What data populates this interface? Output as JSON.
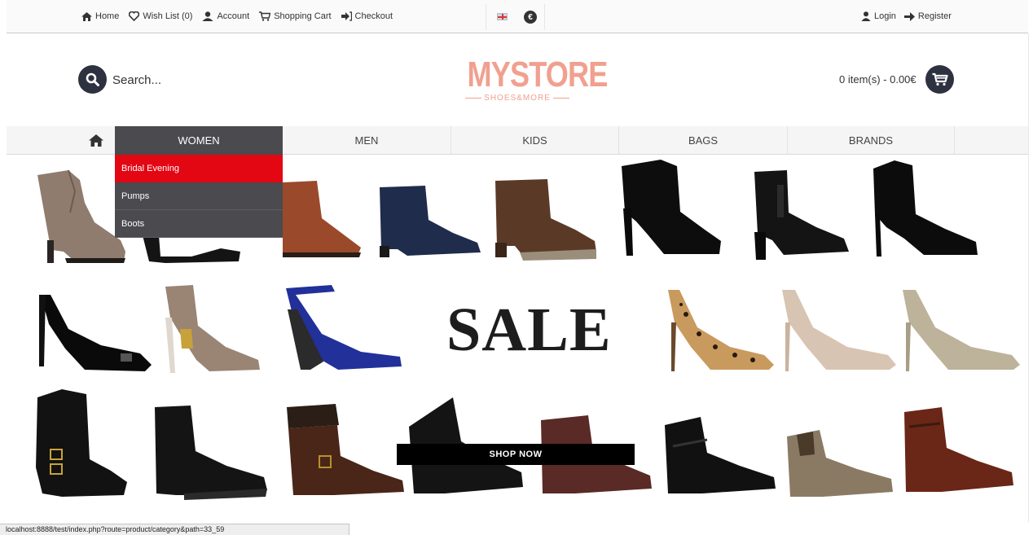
{
  "topbar": {
    "links": [
      {
        "label": "Home",
        "icon": "home-icon"
      },
      {
        "label": "Wish List (0)",
        "icon": "heart-icon"
      },
      {
        "label": "Account",
        "icon": "user-icon"
      },
      {
        "label": "Shopping Cart",
        "icon": "cart-icon"
      },
      {
        "label": "Checkout",
        "icon": "checkout-icon"
      }
    ],
    "language_icon": "uk-flag-icon",
    "currency_symbol": "€",
    "login_label": "Login",
    "register_label": "Register"
  },
  "header": {
    "search_placeholder": "Search...",
    "logo_main": "MYSTORE",
    "logo_sub": "SHOES&MORE",
    "cart_summary": "0 item(s) - 0.00€",
    "brand_color": "#f1a08f",
    "dark_color": "#2e3140"
  },
  "menu": {
    "home_icon": "home-icon",
    "items": [
      {
        "label": "WOMEN",
        "active": true
      },
      {
        "label": "MEN"
      },
      {
        "label": "KIDS"
      },
      {
        "label": "BAGS"
      },
      {
        "label": "BRANDS"
      }
    ],
    "dropdown": [
      {
        "label": "Bridal Evening",
        "highlighted": true
      },
      {
        "label": "Pumps"
      },
      {
        "label": "Boots"
      }
    ],
    "highlight_color": "#e30613"
  },
  "banner": {
    "sale_text": "SALE",
    "button_label": "SHOP NOW"
  },
  "status_bar": {
    "url": "localhost:8888/test/index.php?route=product/category&path=33_59"
  }
}
